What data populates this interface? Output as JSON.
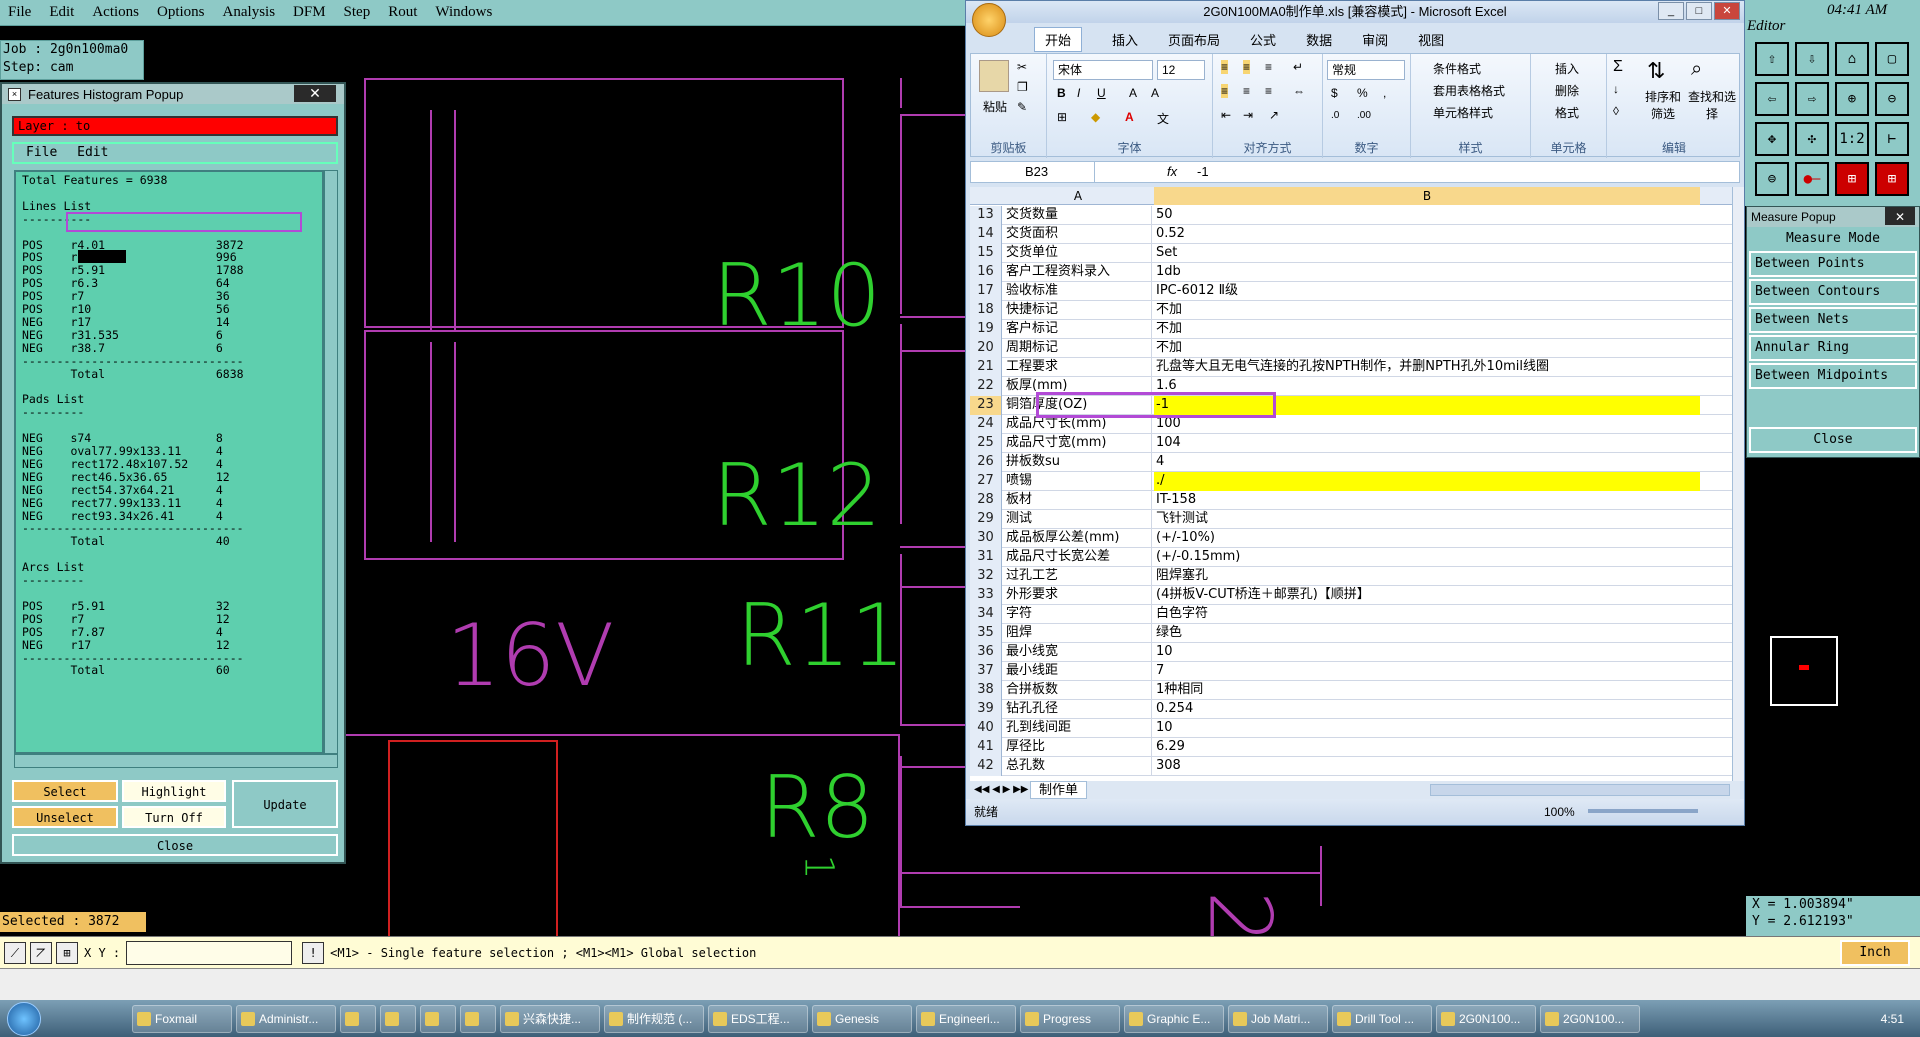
{
  "menubar": {
    "items": [
      "File",
      "Edit",
      "Actions",
      "Options",
      "Analysis",
      "DFM",
      "Step",
      "Rout",
      "Windows"
    ]
  },
  "job": {
    "job_line": "Job : 2g0n100ma0",
    "step_line": "Step: cam"
  },
  "pcb": {
    "labels": [
      "R10",
      "R12",
      "R11",
      "16V",
      "R8",
      "1",
      "2"
    ]
  },
  "histogram": {
    "title": "Features Histogram Popup",
    "layer": "Layer :  to",
    "menu": [
      "File",
      "Edit"
    ],
    "list_text": "Total Features = 6938\n\nLines List\n----------\n\nPOS    r4.01                3872\nPOS    r5                   996\nPOS    r5.91                1788\nPOS    r6.3                 64\nPOS    r7                   36\nPOS    r10                  56\nNEG    r17                  14\nNEG    r31.535              6\nNEG    r38.7                6\n--------------------------------\n       Total                6838\n\nPads List\n---------\n\nNEG    s74                  8\nNEG    oval77.99x133.11     4\nNEG    rect172.48x107.52    4\nNEG    rect46.5x36.65       12\nNEG    rect54.37x64.21      4\nNEG    rect77.99x133.11     4\nNEG    rect93.34x26.41      4\n--------------------------------\n       Total                40\n\nArcs List\n---------\n\nPOS    r5.91                32\nPOS    r7                   12\nPOS    r7.87                4\nNEG    r17                  12\n--------------------------------\n       Total                60",
    "buttons": {
      "select": "Select",
      "highlight": "Highlight",
      "update": "Update",
      "unselect": "Unselect",
      "turnoff": "Turn Off",
      "close": "Close"
    }
  },
  "selected": "Selected : 3872",
  "cmd": {
    "xy_label": "X Y :",
    "hint": "<M1> - Single feature selection ; <M1><M1> Global selection",
    "unit": "Inch"
  },
  "excel": {
    "title": "2G0N100MA0制作单.xls  [兼容模式] - Microsoft Excel",
    "tabs": [
      "开始",
      "插入",
      "页面布局",
      "公式",
      "数据",
      "审阅",
      "视图"
    ],
    "groups": [
      "剪贴板",
      "字体",
      "对齐方式",
      "数字",
      "样式",
      "单元格",
      "编辑"
    ],
    "font_name": "宋体",
    "font_size": "12",
    "number_format": "常规",
    "style_items": [
      "条件格式",
      "套用表格格式",
      "单元格样式"
    ],
    "cell_items": [
      "插入",
      "删除",
      "格式"
    ],
    "edit_items": [
      "排序和筛选",
      "查找和选择"
    ],
    "paste": "粘贴",
    "namebox": "B23",
    "formula": "-1",
    "fx": "fx",
    "col_a": "A",
    "col_b": "B",
    "rows": [
      {
        "n": "13",
        "a": "交货数量",
        "b": "50"
      },
      {
        "n": "14",
        "a": "交货面积",
        "b": "0.52"
      },
      {
        "n": "15",
        "a": "交货单位",
        "b": "Set"
      },
      {
        "n": "16",
        "a": "客户工程资料录入",
        "b": "1db"
      },
      {
        "n": "17",
        "a": "验收标准",
        "b": "IPC-6012 Ⅱ级"
      },
      {
        "n": "18",
        "a": "快捷标记",
        "b": "不加"
      },
      {
        "n": "19",
        "a": "客户标记",
        "b": "不加"
      },
      {
        "n": "20",
        "a": "周期标记",
        "b": "不加"
      },
      {
        "n": "21",
        "a": "工程要求",
        "b": "孔盘等大且无电气连接的孔按NPTH制作，并删NPTH孔外10mil线圈"
      },
      {
        "n": "22",
        "a": "板厚(mm)",
        "b": "1.6"
      },
      {
        "n": "23",
        "a": "铜箔厚度(OZ)",
        "b": "-1"
      },
      {
        "n": "24",
        "a": "成品尺寸长(mm)",
        "b": "100"
      },
      {
        "n": "25",
        "a": "成品尺寸宽(mm)",
        "b": "104"
      },
      {
        "n": "26",
        "a": "拼板数su",
        "b": "4"
      },
      {
        "n": "27",
        "a": "喷锡",
        "b": "./"
      },
      {
        "n": "28",
        "a": "板材",
        "b": "IT-158"
      },
      {
        "n": "29",
        "a": "测试",
        "b": "飞针测试"
      },
      {
        "n": "30",
        "a": "成品板厚公差(mm)",
        "b": "(+/-10%)"
      },
      {
        "n": "31",
        "a": "成品尺寸长宽公差",
        "b": "(+/-0.15mm)"
      },
      {
        "n": "32",
        "a": "过孔工艺",
        "b": "阻焊塞孔"
      },
      {
        "n": "33",
        "a": "外形要求",
        "b": "(4拼板V-CUT桥连＋邮票孔)【顺拼】"
      },
      {
        "n": "34",
        "a": "字符",
        "b": "白色字符"
      },
      {
        "n": "35",
        "a": "阻焊",
        "b": "绿色"
      },
      {
        "n": "36",
        "a": "最小线宽",
        "b": "10"
      },
      {
        "n": "37",
        "a": "最小线距",
        "b": "7"
      },
      {
        "n": "38",
        "a": "合拼板数",
        "b": "1种相同"
      },
      {
        "n": "39",
        "a": "钻孔孔径",
        "b": "0.254"
      },
      {
        "n": "40",
        "a": "孔到线间距",
        "b": "10"
      },
      {
        "n": "41",
        "a": "厚径比",
        "b": "6.29"
      },
      {
        "n": "42",
        "a": "总孔数",
        "b": "308"
      }
    ],
    "sheet_tab": "制作单",
    "status": "就绪",
    "zoom": "100%"
  },
  "rtool": {
    "header": "Editor",
    "time": "04:41 AM",
    "btn_12": "1:2"
  },
  "measure": {
    "title": "Measure Popup",
    "mode": "Measure Mode",
    "options": [
      "Between Points",
      "Between Contours",
      "Between Nets",
      "Annular Ring",
      "Between Midpoints"
    ],
    "close": "Close"
  },
  "coords": {
    "x": "X = 1.003894\"",
    "y": "Y = 2.612193\""
  },
  "taskbar": {
    "items": [
      "Foxmail",
      "Administr...",
      "",
      "",
      "",
      "",
      "兴森快捷...",
      "制作规范 (...",
      "EDS工程...",
      "Genesis",
      "Engineeri...",
      "Progress",
      "Graphic E...",
      "Job Matri...",
      "Drill Tool ...",
      "2G0N100...",
      "2G0N100..."
    ],
    "clock": "4:51"
  },
  "colors": {
    "accent": "#8ec9c6",
    "layer": "#ff0000",
    "highlight_row": "#ffff00",
    "selection_box": "#b24ad6"
  }
}
